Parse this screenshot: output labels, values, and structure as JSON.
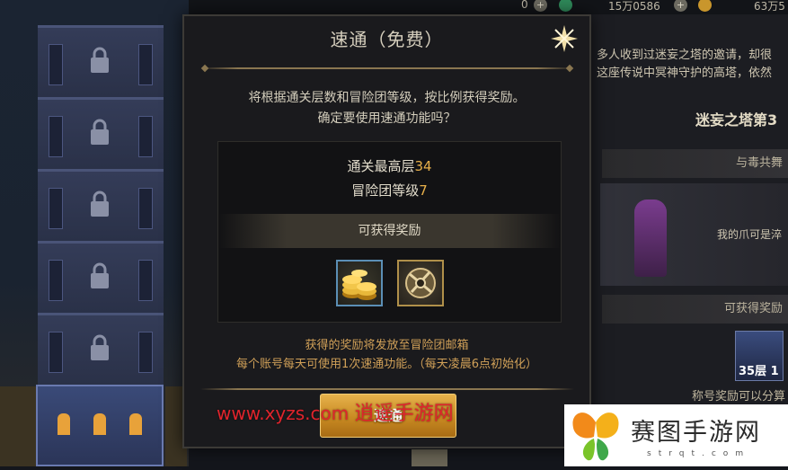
{
  "topbar": {
    "value_a": "0",
    "value_b": "15万0586",
    "value_c": "63万5",
    "plus_glyph": "+"
  },
  "modal": {
    "title": "速通（免费）",
    "description_line1": "将根据通关层数和冒险团等级，按比例获得奖励。",
    "description_line2": "确定要使用速通功能吗？",
    "max_floor_label": "通关最高层",
    "max_floor_value": "34",
    "adventure_level_label": "冒险团等级",
    "adventure_level_value": "7",
    "rewards_header": "可获得奖励",
    "reward_items": [
      "gold-coins-icon",
      "emblem-token-icon"
    ],
    "footnote_line1": "获得的奖励将发放至冒险团邮箱",
    "footnote_line2": "每个账号每天可使用1次速通功能。（每天凌晨6点初始化）",
    "confirm_label": "速通"
  },
  "right_panel": {
    "intro_line1": "多人收到过迷妄之塔的邀请，却很",
    "intro_line2": "这座传说中冥神守护的高塔，依然",
    "tower_title": "迷妄之塔第3",
    "stage_name": "与毒共舞",
    "stage_desc": "我的爪可是淬",
    "rewards_header": "可获得奖励",
    "card_label": "35层 1",
    "footer": "称号奖励可以分算"
  },
  "watermark": {
    "url": "www.xyzs.com",
    "site": "逍遥手游网"
  },
  "logo": {
    "name": "赛图手游网",
    "sub": "strqt.com"
  },
  "colors": {
    "accent_gold": "#e8b04a",
    "watermark_red": "#e0242c",
    "button_gold": "#c98a22"
  }
}
